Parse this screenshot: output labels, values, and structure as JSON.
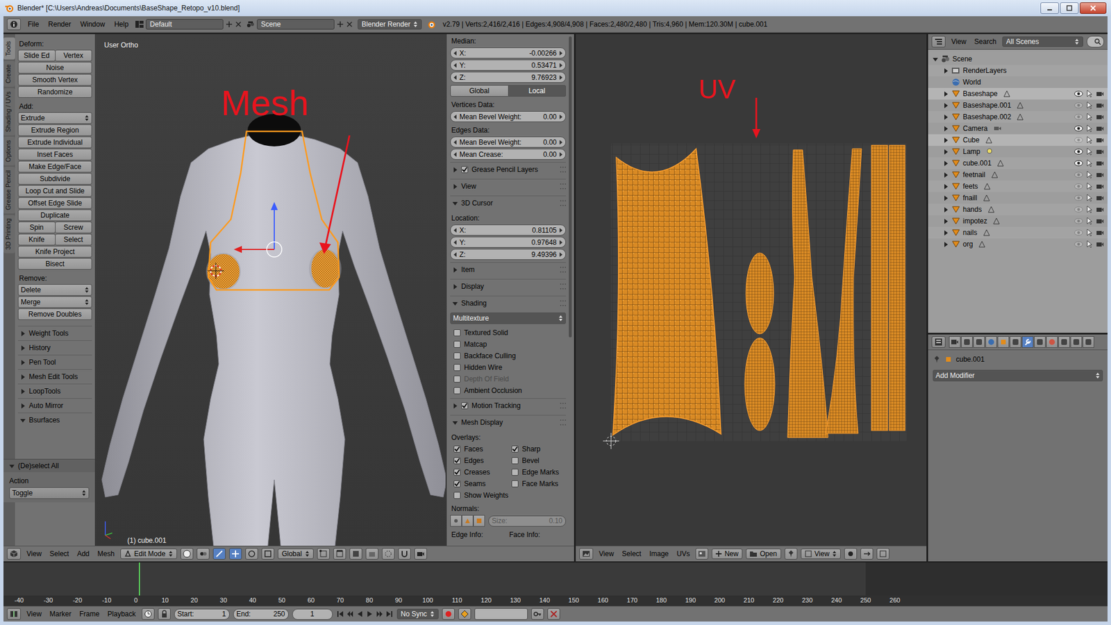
{
  "window": {
    "title": "Blender* [C:\\Users\\Andreas\\Documents\\BaseShape_Retopo_v10.blend]"
  },
  "info_header": {
    "menus": [
      "File",
      "Render",
      "Window",
      "Help"
    ],
    "layout": "Default",
    "scene": "Scene",
    "engine": "Blender Render",
    "stats": "v2.79 | Verts:2,416/2,416 | Edges:4,908/4,908 | Faces:2,480/2,480 | Tris:4,960 | Mem:120.30M | cube.001"
  },
  "tool_shelf": {
    "tabs": [
      {
        "label": "Tools",
        "selected": true
      },
      {
        "label": "Create",
        "selected": false
      },
      {
        "label": "Shading / UVs",
        "selected": false
      },
      {
        "label": "Options",
        "selected": false
      },
      {
        "label": "Grease Pencil",
        "selected": false
      },
      {
        "label": "3D Printing",
        "selected": false
      }
    ],
    "sections": [
      {
        "label": "Deform:",
        "rows": [
          {
            "kind": "button",
            "labels": [
              "Slide Ed",
              "Vertex"
            ]
          },
          {
            "kind": "button",
            "labels": [
              "Noise"
            ]
          },
          {
            "kind": "button",
            "labels": [
              "Smooth Vertex"
            ]
          },
          {
            "kind": "button",
            "labels": [
              "Randomize"
            ]
          }
        ]
      },
      {
        "label": "Add:",
        "rows": [
          {
            "kind": "dropdown",
            "labels": [
              "Extrude"
            ]
          },
          {
            "kind": "button",
            "labels": [
              "Extrude Region"
            ]
          },
          {
            "kind": "button",
            "labels": [
              "Extrude Individual"
            ]
          },
          {
            "kind": "button",
            "labels": [
              "Inset Faces"
            ]
          },
          {
            "kind": "button",
            "labels": [
              "Make Edge/Face"
            ]
          },
          {
            "kind": "button",
            "labels": [
              "Subdivide"
            ]
          },
          {
            "kind": "button",
            "labels": [
              "Loop Cut and Slide"
            ]
          },
          {
            "kind": "button",
            "labels": [
              "Offset Edge Slide"
            ]
          },
          {
            "kind": "button",
            "labels": [
              "Duplicate"
            ]
          },
          {
            "kind": "button",
            "labels": [
              "Spin",
              "Screw"
            ]
          },
          {
            "kind": "button",
            "labels": [
              "Knife",
              "Select"
            ]
          },
          {
            "kind": "button",
            "labels": [
              "Knife Project"
            ]
          },
          {
            "kind": "button",
            "labels": [
              "Bisect"
            ]
          }
        ]
      },
      {
        "label": "Remove:",
        "rows": [
          {
            "kind": "dropdown",
            "labels": [
              "Delete"
            ]
          },
          {
            "kind": "dropdown",
            "labels": [
              "Merge"
            ]
          },
          {
            "kind": "button",
            "labels": [
              "Remove Doubles"
            ]
          }
        ]
      }
    ],
    "panels": [
      {
        "label": "Weight Tools",
        "expanded": false
      },
      {
        "label": "History",
        "expanded": false
      },
      {
        "label": "Pen Tool",
        "expanded": false
      },
      {
        "label": "Mesh Edit Tools",
        "expanded": false
      },
      {
        "label": "LoopTools",
        "expanded": false
      },
      {
        "label": "Auto Mirror",
        "expanded": false
      },
      {
        "label": "Bsurfaces",
        "expanded": true
      }
    ],
    "operator": {
      "title": "(De)select All",
      "expanded": true,
      "field_label": "Action",
      "value": "Toggle"
    }
  },
  "viewport": {
    "view_label": "User Ortho",
    "object_label": "(1) cube.001",
    "annotation": "Mesh"
  },
  "viewport_header": {
    "menus": [
      "View",
      "Select",
      "Add",
      "Mesh"
    ],
    "mode": "Edit Mode",
    "orientation": "Global"
  },
  "n_panel": {
    "rows": [
      {
        "kind": "label",
        "text": "Median:"
      },
      {
        "kind": "field",
        "label": "X:",
        "value": "-0.00266"
      },
      {
        "kind": "field",
        "label": "Y:",
        "value": "0.53471"
      },
      {
        "kind": "field",
        "label": "Z:",
        "value": "9.76923"
      },
      {
        "kind": "toggle",
        "options": [
          {
            "label": "Global",
            "selected": false
          },
          {
            "label": "Local",
            "selected": true
          }
        ]
      },
      {
        "kind": "label",
        "text": "Vertices Data:"
      },
      {
        "kind": "field",
        "label": "Mean Bevel Weight:",
        "value": "0.00"
      },
      {
        "kind": "label",
        "text": "Edges Data:"
      },
      {
        "kind": "field",
        "label": "Mean Bevel Weight:",
        "value": "0.00"
      },
      {
        "kind": "field",
        "label": "Mean Crease:",
        "value": "0.00"
      },
      {
        "kind": "panel",
        "label": "Grease Pencil Layers",
        "expanded": false,
        "checkbox": true,
        "checked": true
      },
      {
        "kind": "panel",
        "label": "View",
        "expanded": false,
        "checkbox": false,
        "checked": false
      },
      {
        "kind": "panel",
        "label": "3D Cursor",
        "expanded": true,
        "checkbox": false,
        "checked": false
      },
      {
        "kind": "label",
        "text": "Location:"
      },
      {
        "kind": "field",
        "label": "X:",
        "value": "0.81105"
      },
      {
        "kind": "field",
        "label": "Y:",
        "value": "0.97648"
      },
      {
        "kind": "field",
        "label": "Z:",
        "value": "9.49396"
      },
      {
        "kind": "panel",
        "label": "Item",
        "expanded": false,
        "checkbox": false,
        "checked": false
      },
      {
        "kind": "panel",
        "label": "Display",
        "expanded": false,
        "checkbox": false,
        "checked": false
      },
      {
        "kind": "panel",
        "label": "Shading",
        "expanded": true,
        "checkbox": false,
        "checked": false
      },
      {
        "kind": "dropdown",
        "value": "Multitexture"
      },
      {
        "kind": "checkbox",
        "label": "Textured Solid",
        "checked": false,
        "disabled": false
      },
      {
        "kind": "checkbox",
        "label": "Matcap",
        "checked": false,
        "disabled": false
      },
      {
        "kind": "checkbox",
        "label": "Backface Culling",
        "checked": false,
        "disabled": false
      },
      {
        "kind": "checkbox",
        "label": "Hidden Wire",
        "checked": false,
        "disabled": false
      },
      {
        "kind": "checkbox",
        "label": "Depth Of Field",
        "checked": false,
        "disabled": true
      },
      {
        "kind": "checkbox",
        "label": "Ambient Occlusion",
        "checked": false,
        "disabled": false
      },
      {
        "kind": "panel",
        "label": "Motion Tracking",
        "expanded": false,
        "checkbox": true,
        "checked": true
      },
      {
        "kind": "panel",
        "label": "Mesh Display",
        "expanded": true,
        "checkbox": false,
        "checked": false
      },
      {
        "kind": "label",
        "text": "Overlays:"
      },
      {
        "kind": "checkpair",
        "items": [
          {
            "label": "Faces",
            "checked": true
          },
          {
            "label": "Sharp",
            "checked": true
          }
        ]
      },
      {
        "kind": "checkpair",
        "items": [
          {
            "label": "Edges",
            "checked": true
          },
          {
            "label": "Bevel",
            "checked": false
          }
        ]
      },
      {
        "kind": "checkpair",
        "items": [
          {
            "label": "Creases",
            "checked": true
          },
          {
            "label": "Edge Marks",
            "checked": false
          }
        ]
      },
      {
        "kind": "checkpair",
        "items": [
          {
            "label": "Seams",
            "checked": true
          },
          {
            "label": "Face Marks",
            "checked": false
          }
        ]
      },
      {
        "kind": "checkbox",
        "label": "Show Weights",
        "checked": false,
        "disabled": false
      },
      {
        "kind": "label",
        "text": "Normals:"
      },
      {
        "kind": "normals",
        "label": "Size:",
        "value": "0.10",
        "disabled": true
      },
      {
        "kind": "infopair",
        "items": [
          "Edge Info:",
          "Face Info:"
        ]
      }
    ]
  },
  "uv_editor": {
    "annotation": "UV",
    "header": {
      "menus": [
        "View",
        "Select",
        "Image",
        "UVs"
      ],
      "new": "New",
      "open": "Open",
      "view": "View"
    }
  },
  "outliner": {
    "header": {
      "menus": [
        "View",
        "Search"
      ],
      "filter": "All Scenes"
    },
    "items": [
      {
        "label": "Scene",
        "depth": 0,
        "kind": "scene",
        "expandable": true,
        "expanded": true,
        "selected": false,
        "visible": false
      },
      {
        "label": "RenderLayers",
        "depth": 1,
        "kind": "renderlayers",
        "expandable": true,
        "expanded": false,
        "selected": false,
        "visible": false
      },
      {
        "label": "World",
        "depth": 1,
        "kind": "world",
        "expandable": false,
        "expanded": false,
        "selected": false,
        "visible": false
      },
      {
        "label": "Baseshape",
        "depth": 1,
        "kind": "mesh",
        "expandable": true,
        "expanded": false,
        "selected": true,
        "visible": true
      },
      {
        "label": "Baseshape.001",
        "depth": 1,
        "kind": "mesh",
        "expandable": true,
        "expanded": false,
        "selected": false,
        "visible": false
      },
      {
        "label": "Baseshape.002",
        "depth": 1,
        "kind": "mesh",
        "expandable": true,
        "expanded": false,
        "selected": false,
        "visible": false
      },
      {
        "label": "Camera",
        "depth": 1,
        "kind": "camera",
        "expandable": true,
        "expanded": false,
        "selected": false,
        "visible": true
      },
      {
        "label": "Cube",
        "depth": 1,
        "kind": "mesh",
        "expandable": true,
        "expanded": false,
        "selected": true,
        "visible": false
      },
      {
        "label": "Lamp",
        "depth": 1,
        "kind": "lamp",
        "expandable": true,
        "expanded": false,
        "selected": false,
        "visible": true
      },
      {
        "label": "cube.001",
        "depth": 1,
        "kind": "mesh",
        "expandable": true,
        "expanded": false,
        "selected": false,
        "visible": true
      },
      {
        "label": "feetnail",
        "depth": 1,
        "kind": "mesh",
        "expandable": true,
        "expanded": false,
        "selected": false,
        "visible": false
      },
      {
        "label": "feets",
        "depth": 1,
        "kind": "mesh",
        "expandable": true,
        "expanded": false,
        "selected": false,
        "visible": false
      },
      {
        "label": "fnaill",
        "depth": 1,
        "kind": "mesh",
        "expandable": true,
        "expanded": false,
        "selected": false,
        "visible": false
      },
      {
        "label": "hands",
        "depth": 1,
        "kind": "mesh",
        "expandable": true,
        "expanded": false,
        "selected": false,
        "visible": false
      },
      {
        "label": "impotez",
        "depth": 1,
        "kind": "mesh",
        "expandable": true,
        "expanded": false,
        "selected": false,
        "visible": false
      },
      {
        "label": "nails",
        "depth": 1,
        "kind": "mesh",
        "expandable": true,
        "expanded": false,
        "selected": false,
        "visible": false
      },
      {
        "label": "org",
        "depth": 1,
        "kind": "mesh",
        "expandable": true,
        "expanded": false,
        "selected": false,
        "visible": false
      }
    ]
  },
  "properties": {
    "tabs": [
      {
        "kind": "render",
        "selected": false
      },
      {
        "kind": "layers",
        "selected": false
      },
      {
        "kind": "scene",
        "selected": false
      },
      {
        "kind": "world",
        "selected": false
      },
      {
        "kind": "object",
        "selected": false
      },
      {
        "kind": "constraints",
        "selected": false
      },
      {
        "kind": "modifiers",
        "selected": true
      },
      {
        "kind": "data",
        "selected": false
      },
      {
        "kind": "material",
        "selected": false
      },
      {
        "kind": "texture",
        "selected": false
      },
      {
        "kind": "particles",
        "selected": false
      },
      {
        "kind": "physics",
        "selected": false
      }
    ],
    "object": "cube.001",
    "add_modifier": "Add Modifier"
  },
  "timeline": {
    "ticks": [
      "-40",
      "-30",
      "-20",
      "-10",
      "0",
      "10",
      "20",
      "30",
      "40",
      "50",
      "60",
      "70",
      "80",
      "90",
      "100",
      "110",
      "120",
      "130",
      "140",
      "150",
      "160",
      "170",
      "180",
      "190",
      "200",
      "210",
      "220",
      "230",
      "240",
      "250",
      "260"
    ],
    "header": {
      "menus": [
        "View",
        "Marker",
        "Frame",
        "Playback"
      ],
      "start_label": "Start:",
      "start": "1",
      "end_label": "End:",
      "end": "250",
      "current": "1",
      "sync": "No Sync"
    }
  }
}
